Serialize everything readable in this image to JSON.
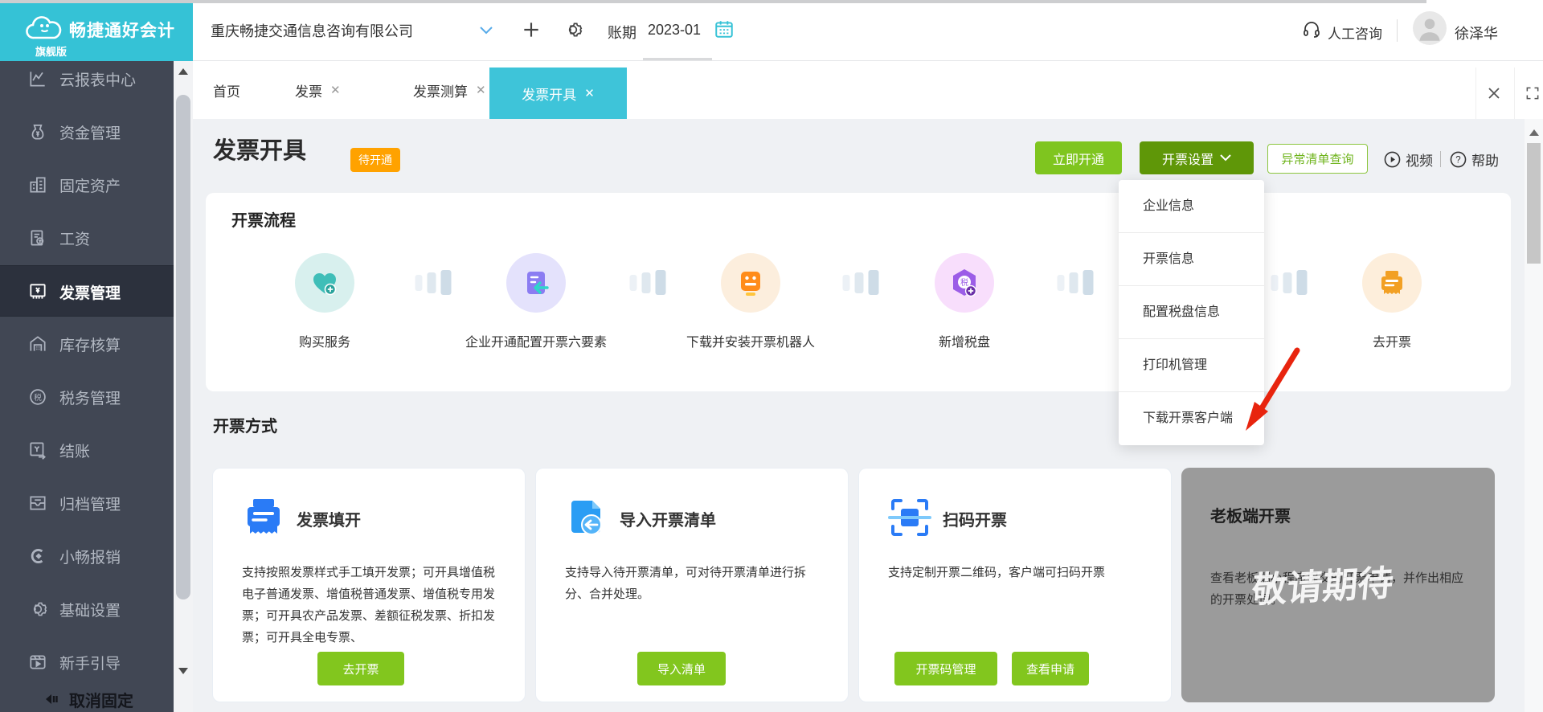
{
  "brand": {
    "name": "畅捷通好会计",
    "edition": "旗舰版"
  },
  "header": {
    "company": "重庆畅捷交通信息咨询有限公司",
    "period_label": "账期",
    "period_value": "2023-01",
    "consult_label": "人工咨询",
    "username": "徐泽华"
  },
  "sidebar": {
    "items": [
      {
        "label": "云报表中心"
      },
      {
        "label": "资金管理"
      },
      {
        "label": "固定资产"
      },
      {
        "label": "工资"
      },
      {
        "label": "发票管理"
      },
      {
        "label": "库存核算"
      },
      {
        "label": "税务管理"
      },
      {
        "label": "结账"
      },
      {
        "label": "归档管理"
      },
      {
        "label": "小畅报销"
      },
      {
        "label": "基础设置"
      },
      {
        "label": "新手引导"
      }
    ],
    "pin_label": "取消固定"
  },
  "tabs": {
    "home": "首页",
    "invoice": "发票",
    "calc": "发票测算",
    "issue": "发票开具"
  },
  "page": {
    "title": "发票开具",
    "badge": "待开通"
  },
  "actions": {
    "activate": "立即开通",
    "settings": "开票设置",
    "abnormal": "异常清单查询",
    "video": "视频",
    "help": "帮助"
  },
  "settings_menu": {
    "items": [
      {
        "label": "企业信息"
      },
      {
        "label": "开票信息"
      },
      {
        "label": "配置税盘信息"
      },
      {
        "label": "打印机管理"
      },
      {
        "label": "下载开票客户端"
      }
    ]
  },
  "flow": {
    "heading": "开票流程",
    "steps": [
      {
        "label": "购买服务"
      },
      {
        "label": "企业开通配置开票六要素"
      },
      {
        "label": "下载并安装开票机器人"
      },
      {
        "label": "新增税盘"
      },
      {
        "label": "去开票"
      }
    ]
  },
  "methods": {
    "heading": "开票方式",
    "cards": [
      {
        "title": "发票填开",
        "desc": "支持按照发票样式手工填开发票；可开具增值税电子普通发票、增值税普通发票、增值税专用发票；可开具农产品发票、差额征税发票、折扣发票；可开具全电专票、",
        "button": "去开票"
      },
      {
        "title": "导入开票清单",
        "desc": "支持导入待开票清单，可对待开票清单进行拆分、合并处理。",
        "button": "导入清单"
      },
      {
        "title": "扫码开票",
        "desc": "支持定制开票二维码，客户端可扫码开票",
        "button1": "开票码管理",
        "button2": "查看申请"
      },
      {
        "title": "老板端开票",
        "desc": "查看老板端小程序提交的开票申请，并作出相应的开票处理。",
        "watermark": "敬请期待"
      }
    ]
  },
  "colors": {
    "brand_teal": "#35c2d6",
    "green": "#7fc51f",
    "dark_green": "#5f9708",
    "badge_orange": "#ffa200",
    "red_arrow": "#e8240e"
  }
}
